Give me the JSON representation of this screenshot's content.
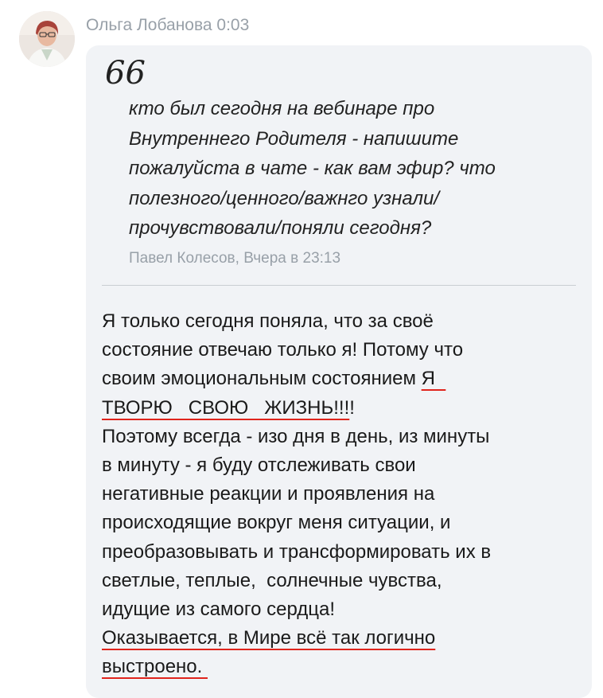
{
  "sender": {
    "name": "Ольга Лобанова",
    "time": "0:03"
  },
  "quote": {
    "mark": "66",
    "lines": [
      "кто был сегодня на вебинаре про",
      "Внутреннего Родителя - напишите",
      "пожалуйста в чате - как вам эфир? что",
      "полезного/ценного/важнго узнали/",
      "прочувствовали/поняли сегодня?"
    ],
    "author": "Павел Колесов, Вчера в 23:13"
  },
  "message": {
    "line1": "Я только сегодня поняла, что за своё",
    "line2": "состояние отвечаю только я! Потому что",
    "line3_a": "своим эмоциональным состоянием ",
    "line3_b": "Я  ",
    "line4_a": "ТВОРЮ   СВОЮ   ЖИЗНЬ!!!",
    "line4_b": "!",
    "line5": "Поэтому всегда - изо дня в день, из минуты",
    "line6": "в минуту - я буду отслеживать свои",
    "line7": "негативные реакции и проявления на",
    "line8": "происходящие вокруг меня ситуации, и",
    "line9": "преобразовывать и трансформировать их в",
    "line10": "светлые, теплые,  солнечные чувства,",
    "line11": "идущие из самого сердца!",
    "line12": "Оказывается, в Мире всё так логично",
    "line13": "выстроено. "
  },
  "colors": {
    "underline": "#e0241c",
    "bubble": "#f1f3f6",
    "meta_text": "#98a0a8"
  }
}
